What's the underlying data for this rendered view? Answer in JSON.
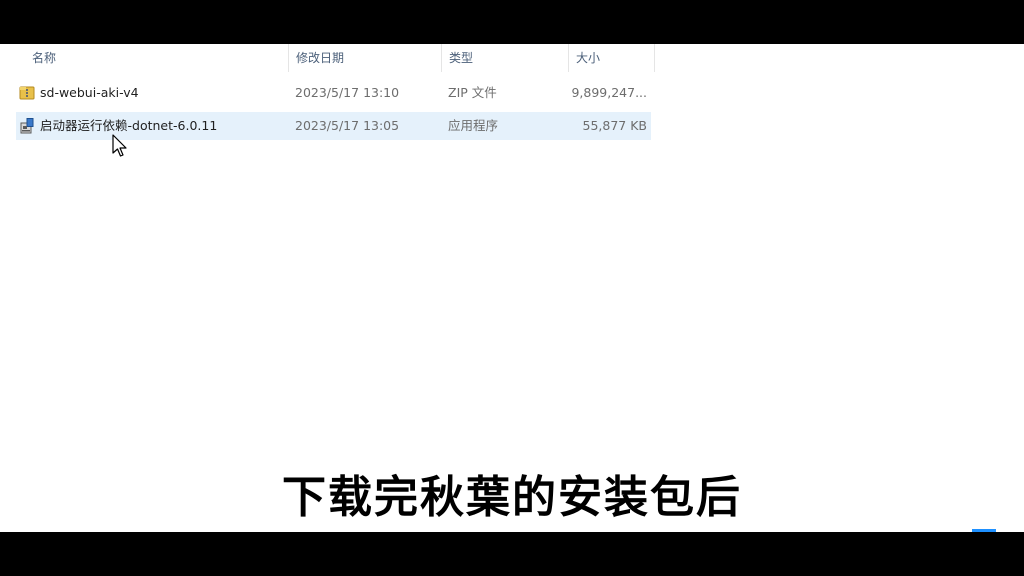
{
  "header": {
    "name_label": "名称",
    "modified_label": "修改日期",
    "type_label": "类型",
    "size_label": "大小"
  },
  "files": [
    {
      "name": "sd-webui-aki-v4",
      "modified": "2023/5/17 13:10",
      "type": "ZIP 文件",
      "size": "9,899,247...",
      "icon": "zip-folder-icon",
      "selected": false
    },
    {
      "name": "启动器运行依赖-dotnet-6.0.11",
      "modified": "2023/5/17 13:05",
      "type": "应用程序",
      "size": "55,877 KB",
      "icon": "installer-icon",
      "selected": true
    }
  ],
  "subtitle": "下载完秋葉的安装包后",
  "colors": {
    "selection": "#e5f1fb",
    "header_text": "#4c607a",
    "subtitle_text": "#000000"
  }
}
